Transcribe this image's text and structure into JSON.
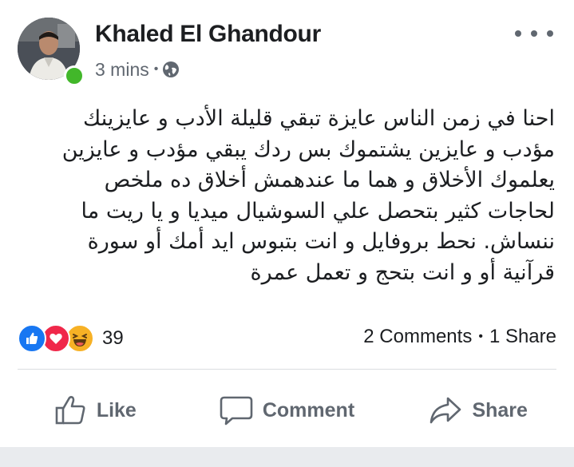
{
  "post": {
    "author": "Khaled El Ghandour",
    "time": "3 mins",
    "separator": "•",
    "privacy_icon": "globe-icon",
    "more_icon": "more-options-icon",
    "text_lines": [
      "احنا في زمن الناس عايزة تبقي قليلة الأدب و عايزينك",
      "مؤدب و عايزين يشتموك بس ردك يبقي مؤدب و عايزين",
      "يعلموك الأخلاق و هما ما عندهمش أخلاق ده ملخص",
      "لحاجات كثير بتحصل علي السوشيال ميديا و يا ريت ما",
      "ننساش. نحط بروفايل و انت بتبوس ايد أمك أو سورة",
      "قرآنية  أو و انت بتحج و تعمل عمرة"
    ]
  },
  "reactions": {
    "icons": [
      "like-reaction-icon",
      "love-reaction-icon",
      "haha-reaction-icon"
    ],
    "count": "39"
  },
  "engagement": {
    "comments": "2 Comments",
    "separator": "•",
    "shares": "1 Share"
  },
  "actions": {
    "like": "Like",
    "comment": "Comment",
    "share": "Share"
  },
  "colors": {
    "text": "#1c1e21",
    "secondary": "#606770",
    "online": "#42b72a",
    "like_blue": "#1877f2",
    "love_red": "#f0284a",
    "haha_yellow": "#f7b125"
  }
}
